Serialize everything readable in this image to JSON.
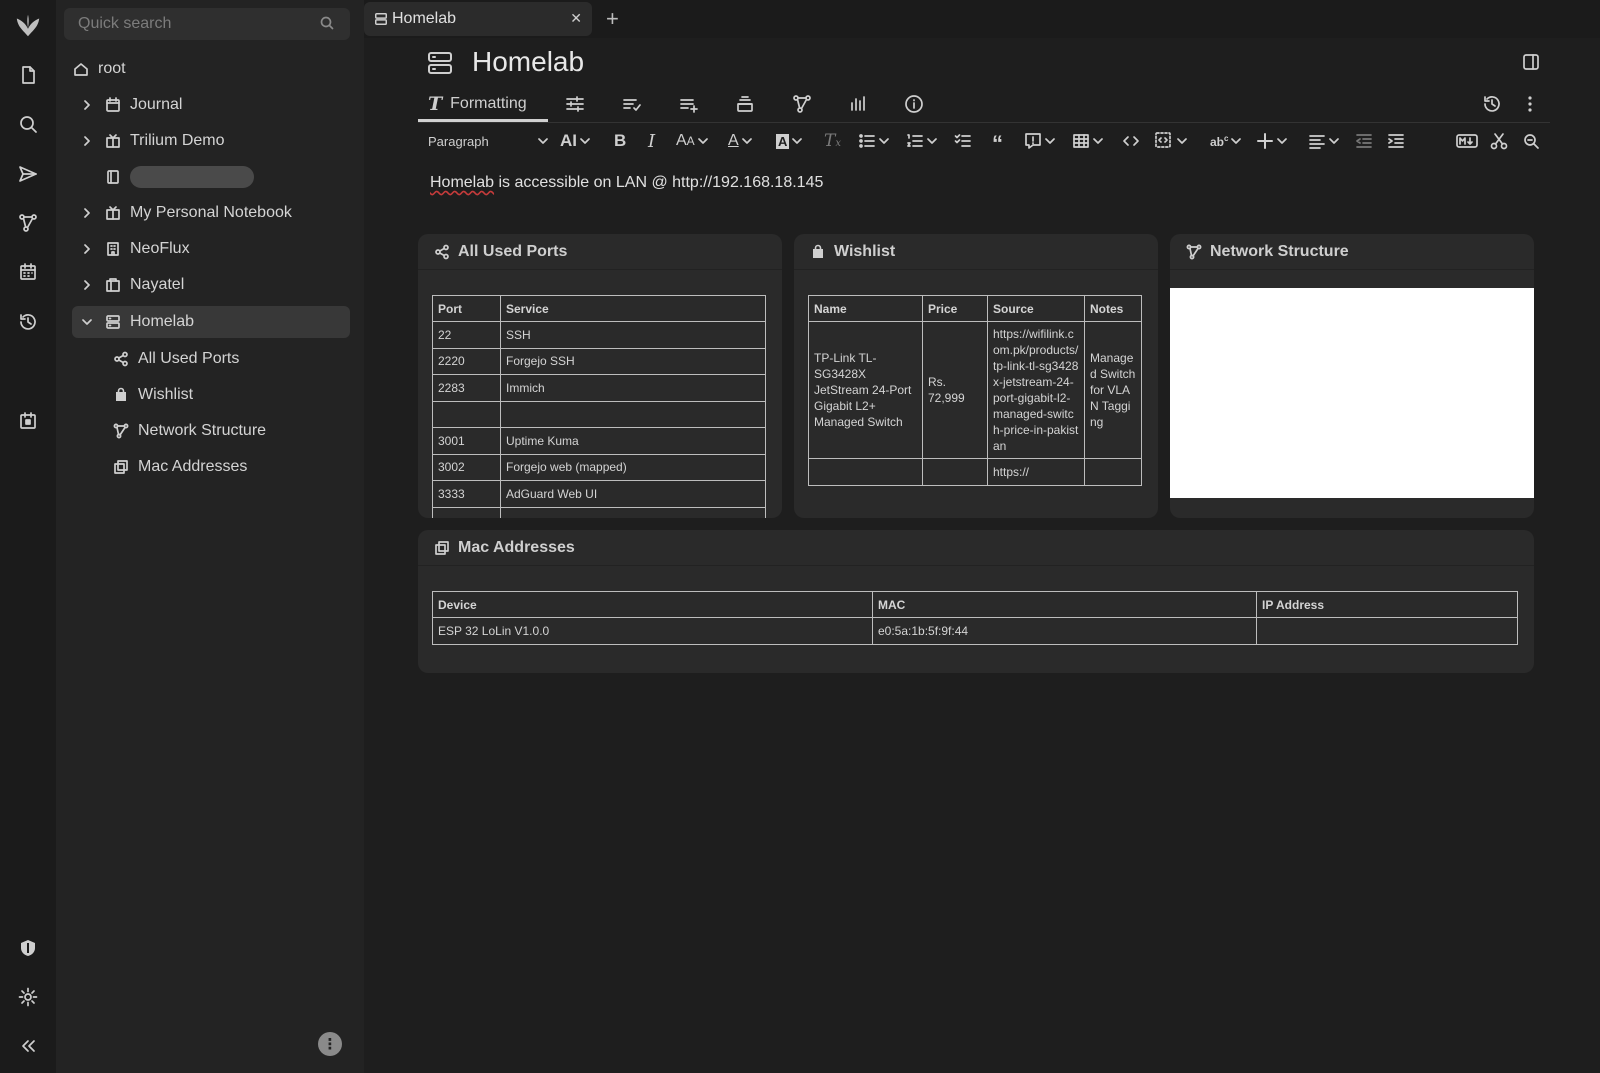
{
  "sidebar": {
    "search_placeholder": "Quick search",
    "tree": {
      "root": "root",
      "journal": "Journal",
      "trilium_demo": "Trilium Demo",
      "personal_notebook": "My Personal Notebook",
      "neoflux": "NeoFlux",
      "nayatel": "Nayatel",
      "homelab": "Homelab",
      "children": [
        "All Used Ports",
        "Wishlist",
        "Network Structure",
        "Mac Addresses"
      ]
    }
  },
  "tabs": [
    {
      "label": "Homelab"
    }
  ],
  "note": {
    "title": "Homelab",
    "ribbon_active": "Formatting",
    "paragraph_style": "Paragraph",
    "text_prefix": "Homelab",
    "text_rest": " is accessible on LAN @ http://192.168.18.145"
  },
  "cards": {
    "ports": {
      "title": "All Used Ports",
      "headers": [
        "Port",
        "Service"
      ],
      "rows": [
        [
          "22",
          "SSH"
        ],
        [
          "2220",
          "Forgejo SSH"
        ],
        [
          "2283",
          "Immich"
        ],
        [
          "",
          ""
        ],
        [
          "3001",
          "Uptime Kuma"
        ],
        [
          "3002",
          "Forgejo web (mapped)"
        ],
        [
          "3333",
          "AdGuard Web UI"
        ]
      ]
    },
    "wishlist": {
      "title": "Wishlist",
      "headers": [
        "Name",
        "Price",
        "Source",
        "Notes"
      ],
      "rows": [
        [
          "TP-Link TL-SG3428X JetStream 24-Port Gigabit L2+ Managed Switch",
          "Rs. 72,999",
          "https://wifilink.com.pk/products/tp-link-tl-sg3428x-jetstream-24-port-gigabit-l2-managed-switch-price-in-pakistan",
          "Managed Switch for VLAN Tagging"
        ],
        [
          "",
          "",
          "https://",
          ""
        ]
      ]
    },
    "network": {
      "title": "Network Structure"
    },
    "mac": {
      "title": "Mac Addresses",
      "headers": [
        "Device",
        "MAC",
        "IP Address"
      ],
      "rows": [
        [
          "ESP 32 LoLin V1.0.0",
          "e0:5a:1b:5f:9f:44",
          ""
        ]
      ]
    }
  }
}
